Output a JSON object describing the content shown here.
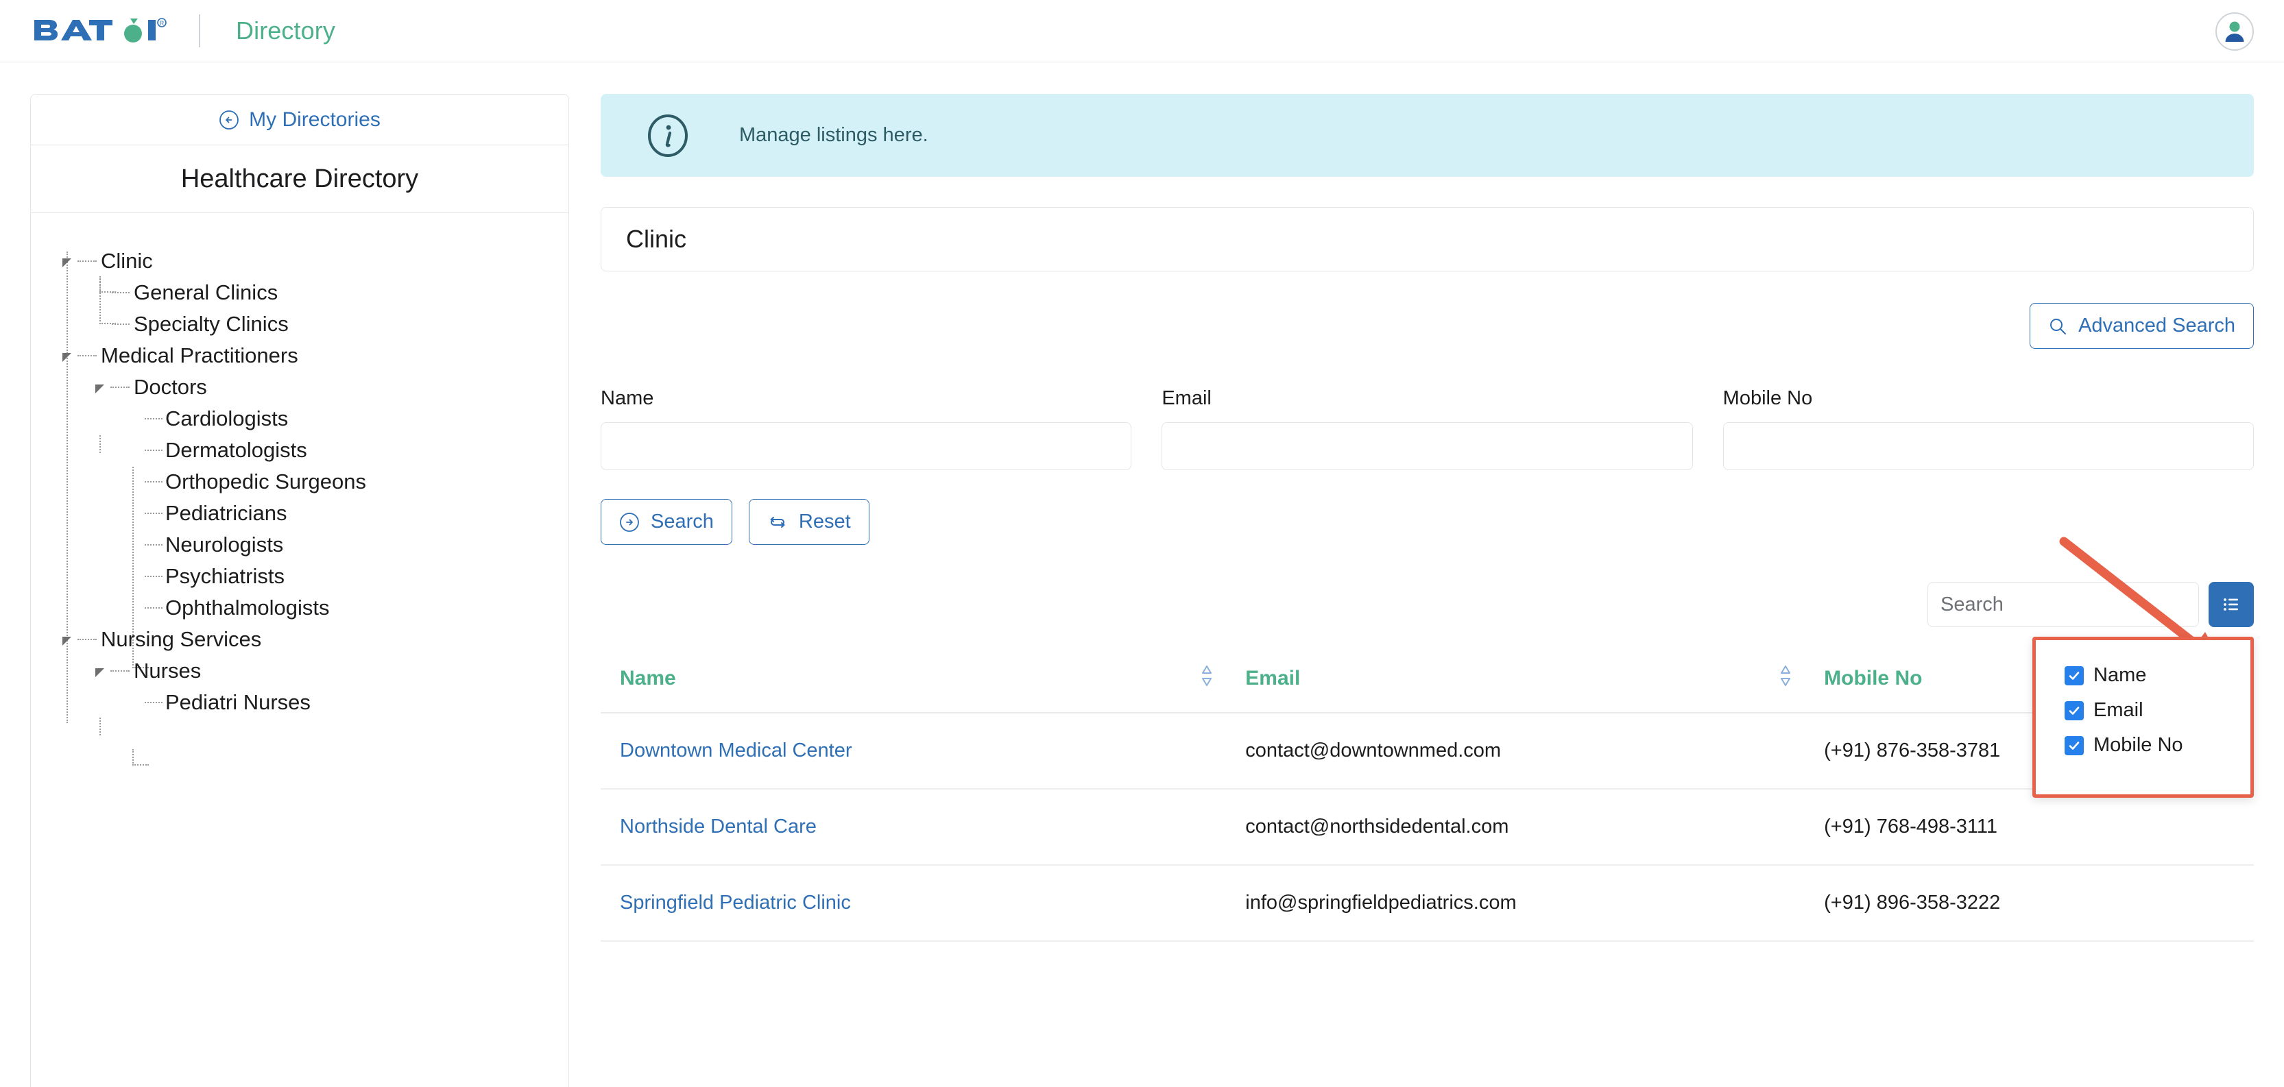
{
  "header": {
    "logo_text": "BATOI",
    "logo_icon": "batoi-leaf-logo",
    "app_name": "Directory",
    "avatar_icon": "user-avatar-icon"
  },
  "sidebar": {
    "my_directories_label": "My Directories",
    "back_icon": "circle-arrow-left-icon",
    "directory_title": "Healthcare Directory",
    "tree": [
      {
        "label": "Clinic",
        "level": 1,
        "expandable": true
      },
      {
        "label": "General Clinics",
        "level": 2,
        "expandable": false
      },
      {
        "label": "Specialty Clinics",
        "level": 2,
        "expandable": false
      },
      {
        "label": "Medical Practitioners",
        "level": 1,
        "expandable": true
      },
      {
        "label": "Doctors",
        "level": 2,
        "expandable": true
      },
      {
        "label": "Cardiologists",
        "level": 3,
        "expandable": false
      },
      {
        "label": "Dermatologists",
        "level": 3,
        "expandable": false
      },
      {
        "label": "Orthopedic Surgeons",
        "level": 3,
        "expandable": false
      },
      {
        "label": "Pediatricians",
        "level": 3,
        "expandable": false
      },
      {
        "label": "Neurologists",
        "level": 3,
        "expandable": false
      },
      {
        "label": "Psychiatrists",
        "level": 3,
        "expandable": false
      },
      {
        "label": "Ophthalmologists",
        "level": 3,
        "expandable": false
      },
      {
        "label": "Nursing Services",
        "level": 1,
        "expandable": true
      },
      {
        "label": "Nurses",
        "level": 2,
        "expandable": true
      },
      {
        "label": "Pediatri Nurses",
        "level": 3,
        "expandable": false
      }
    ]
  },
  "main": {
    "info_banner": {
      "icon": "info-circle-icon",
      "text": "Manage listings here."
    },
    "panel_title": "Clinic",
    "advanced_search": {
      "label": "Advanced Search",
      "icon": "search-icon"
    },
    "filters": [
      {
        "label": "Name",
        "value": "",
        "placeholder": ""
      },
      {
        "label": "Email",
        "value": "",
        "placeholder": ""
      },
      {
        "label": "Mobile No",
        "value": "",
        "placeholder": ""
      }
    ],
    "buttons": {
      "search_label": "Search",
      "search_icon": "circle-arrow-right-icon",
      "reset_label": "Reset",
      "reset_icon": "refresh-icon"
    },
    "table_search": {
      "value": "",
      "placeholder": "Search"
    },
    "column_toggle_button": {
      "icon": "list-ul-icon"
    },
    "column_dropdown": {
      "visible": true,
      "items": [
        {
          "label": "Name",
          "checked": true
        },
        {
          "label": "Email",
          "checked": true
        },
        {
          "label": "Mobile No",
          "checked": true
        }
      ]
    },
    "table": {
      "columns": [
        "Name",
        "Email",
        "Mobile No"
      ],
      "sort_icon": "sort-updown-icon",
      "rows": [
        {
          "name": "Downtown Medical Center",
          "email": "contact@downtownmed.com",
          "mobile": "(+91) 876-358-3781"
        },
        {
          "name": "Northside Dental Care",
          "email": "contact@northsidedental.com",
          "mobile": "(+91) 768-498-3111"
        },
        {
          "name": "Springfield Pediatric Clinic",
          "email": "info@springfieldpediatrics.com",
          "mobile": "(+91) 896-358-3222"
        }
      ]
    }
  },
  "annotations": {
    "arrow_icon": "red-pointer-arrow",
    "highlight_color": "#e8624a"
  },
  "colors": {
    "brand_blue": "#2f6fb5",
    "brand_green": "#4cb08a",
    "info_bg": "#d3f1f7",
    "annotation_red": "#e8624a",
    "checkbox_blue": "#2680eb"
  }
}
